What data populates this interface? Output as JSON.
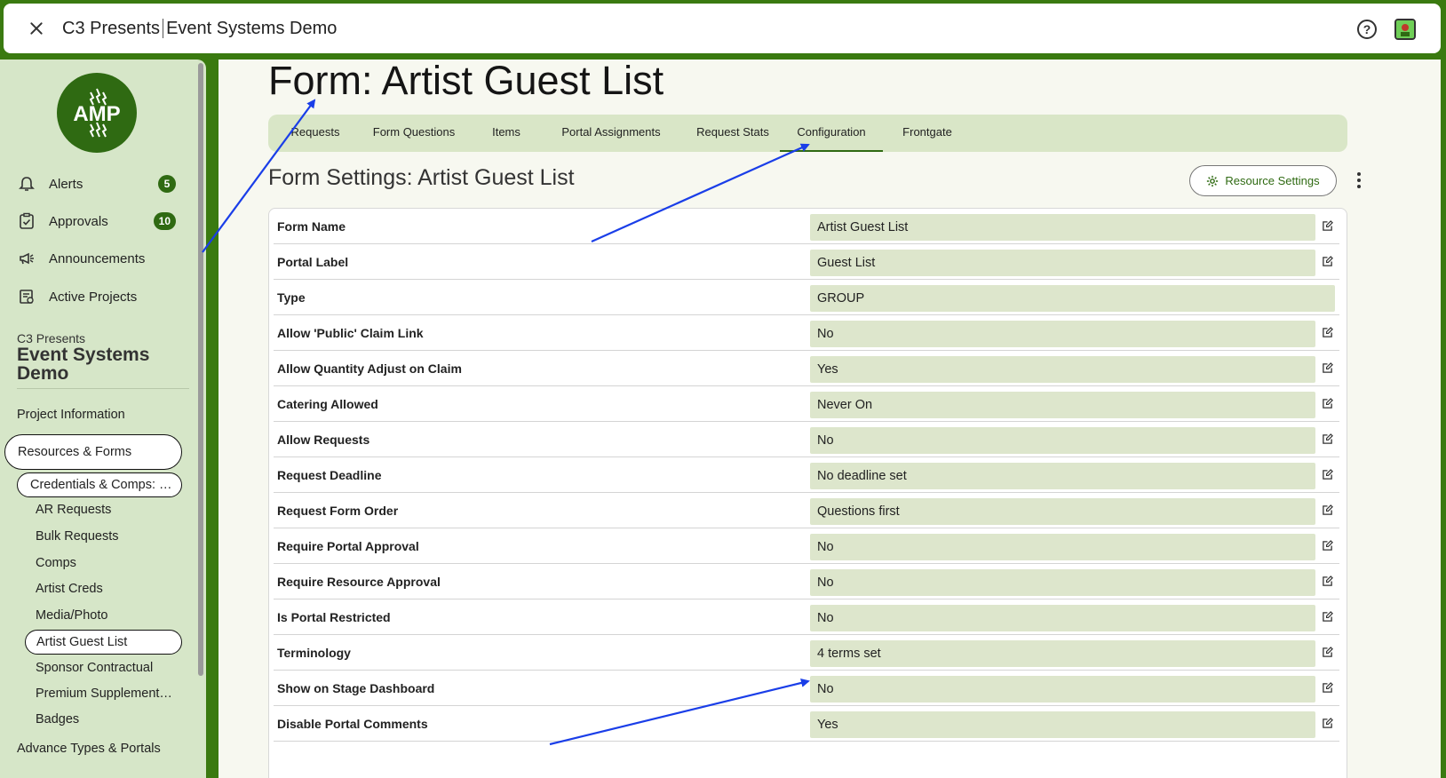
{
  "app": {
    "org": "C3 Presents",
    "project": "Event Systems Demo"
  },
  "sidebar": {
    "logo_text": "AMP",
    "nav": [
      {
        "label": "Alerts",
        "badge": "5",
        "icon": "bell-icon"
      },
      {
        "label": "Approvals",
        "badge": "10",
        "icon": "clipboard-check-icon"
      },
      {
        "label": "Announcements",
        "badge": "",
        "icon": "megaphone-icon"
      },
      {
        "label": "Active Projects",
        "badge": "",
        "icon": "projects-icon"
      }
    ],
    "project_org": "C3 Presents",
    "project_name": "Event Systems Demo",
    "project_information": "Project Information",
    "resources_forms": "Resources & Forms",
    "credentials_group": "Credentials & Comps: …",
    "sub_items": [
      "AR Requests",
      "Bulk Requests",
      "Comps",
      "Artist Creds",
      "Media/Photo",
      "Artist Guest List",
      "Sponsor Contractual",
      "Premium Supplement…",
      "Badges"
    ],
    "cut_off_item": "Advance Types & Portals"
  },
  "main": {
    "page_title": "Form: Artist Guest List",
    "tabs": [
      "Requests",
      "Form Questions",
      "Items",
      "Portal Assignments",
      "Request Stats",
      "Configuration",
      "Frontgate"
    ],
    "active_tab": "Configuration",
    "section_title": "Form Settings: Artist Guest List",
    "resource_settings_label": "Resource Settings",
    "settings": [
      {
        "label": "Form Name",
        "value": "Artist Guest List",
        "editable": true
      },
      {
        "label": "Portal Label",
        "value": "Guest List",
        "editable": true
      },
      {
        "label": "Type",
        "value": "GROUP",
        "editable": false
      },
      {
        "label": "Allow 'Public' Claim Link",
        "value": "No",
        "editable": true
      },
      {
        "label": "Allow Quantity Adjust on Claim",
        "value": "Yes",
        "editable": true
      },
      {
        "label": "Catering Allowed",
        "value": "Never On",
        "editable": true
      },
      {
        "label": "Allow Requests",
        "value": "No",
        "editable": true
      },
      {
        "label": "Request Deadline",
        "value": "No deadline set",
        "editable": true
      },
      {
        "label": "Request Form Order",
        "value": "Questions first",
        "editable": true
      },
      {
        "label": "Require Portal Approval",
        "value": "No",
        "editable": true
      },
      {
        "label": "Require Resource Approval",
        "value": "No",
        "editable": true
      },
      {
        "label": "Is Portal Restricted",
        "value": "No",
        "editable": true
      },
      {
        "label": "Terminology",
        "value": "4 terms set",
        "editable": true
      },
      {
        "label": "Show on Stage Dashboard",
        "value": "No",
        "editable": true
      },
      {
        "label": "Disable Portal Comments",
        "value": "Yes",
        "editable": true
      }
    ]
  },
  "colors": {
    "brand_green": "#2f6a12",
    "sidebar_bg": "#d6e6c8",
    "value_bg": "#dde6cc",
    "annotation_arrow": "#1a3ee8"
  }
}
